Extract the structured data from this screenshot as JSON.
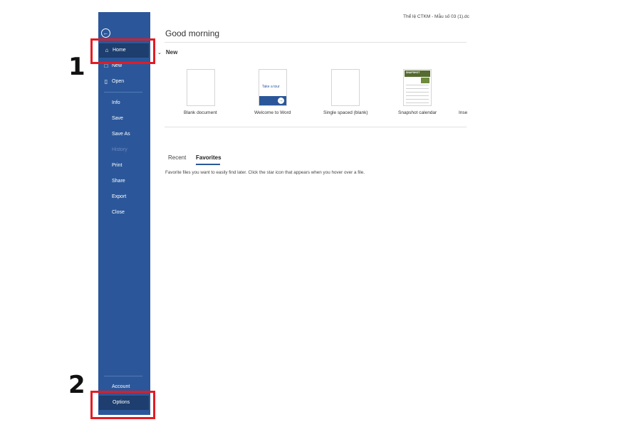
{
  "document": {
    "title": "Thể lệ CTKM - Mẫu số 03 (1).dc"
  },
  "sidebar": {
    "items": [
      {
        "label": "Home",
        "icon": "home-icon"
      },
      {
        "label": "New",
        "icon": "new-document-icon"
      },
      {
        "label": "Open",
        "icon": "folder-open-icon"
      },
      {
        "label": "Info"
      },
      {
        "label": "Save"
      },
      {
        "label": "Save As"
      },
      {
        "label": "History"
      },
      {
        "label": "Print"
      },
      {
        "label": "Share"
      },
      {
        "label": "Export"
      },
      {
        "label": "Close"
      }
    ],
    "footer": [
      {
        "label": "Account"
      },
      {
        "label": "Options"
      }
    ]
  },
  "main": {
    "greeting": "Good morning",
    "new_section": {
      "title": "New",
      "templates": [
        {
          "label": "Blank document"
        },
        {
          "label": "Welcome to Word",
          "thumb_text": "Take a tour"
        },
        {
          "label": "Single spaced (blank)"
        },
        {
          "label": "Snapshot calendar",
          "thumb_text": "SNAPSHOT"
        },
        {
          "label": "Inse"
        }
      ]
    },
    "tabs": [
      {
        "label": "Recent"
      },
      {
        "label": "Favorites"
      }
    ],
    "favorites_message": "Favorite files you want to easily find later. Click the star icon that appears when you hover over a file."
  },
  "callouts": [
    {
      "number": "1"
    },
    {
      "number": "2"
    }
  ],
  "colors": {
    "sidebar": "#2b579a",
    "active": "#1d3e6e",
    "callout": "#e31b23"
  }
}
